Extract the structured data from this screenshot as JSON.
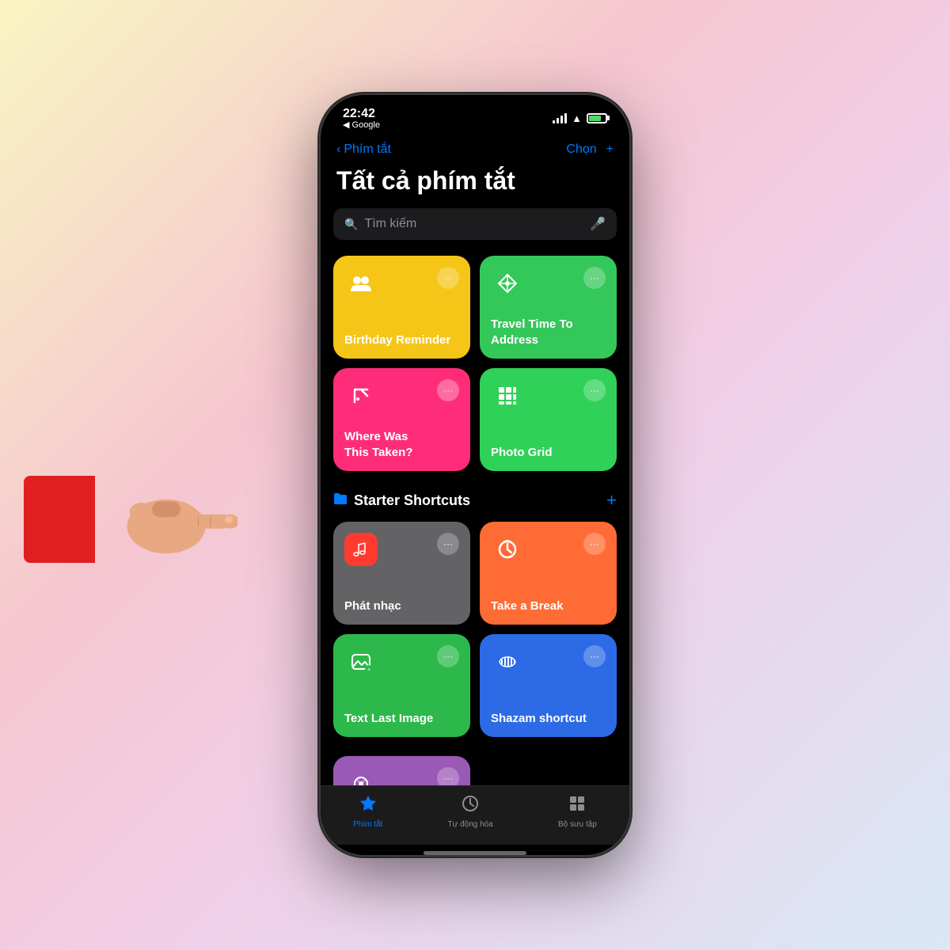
{
  "background": {
    "gradient": "linear-gradient(135deg, #f9f5c2, #f5c6d0, #e8d5f0, #d0e8f5)"
  },
  "statusBar": {
    "time": "22:42",
    "backLabel": "◀ Google",
    "timeIcon": "▶"
  },
  "navigation": {
    "backLabel": "Phím tắt",
    "title": "",
    "chooseLabel": "Chọn",
    "addLabel": "+"
  },
  "pageTitle": "Tất cả phím tắt",
  "search": {
    "placeholder": "Tìm kiếm"
  },
  "myShortcuts": [
    {
      "id": "birthday",
      "name": "Birthday Reminder",
      "icon": "👥",
      "color": "card-yellow"
    },
    {
      "id": "travel",
      "name": "Travel Time To Address",
      "icon": "✨",
      "color": "card-green"
    },
    {
      "id": "where-taken",
      "name": "Where Was This Taken?",
      "icon": "✨",
      "color": "card-pink"
    },
    {
      "id": "photo-grid",
      "name": "Photo Grid",
      "icon": "⊞",
      "color": "card-green2"
    }
  ],
  "starterSection": {
    "title": "Starter Shortcuts",
    "icon": "📁"
  },
  "starterShortcuts": [
    {
      "id": "music",
      "name": "Phát nhạc",
      "icon": "🎵",
      "color": "card-gray"
    },
    {
      "id": "break",
      "name": "Take a Break",
      "icon": "⏰",
      "color": "card-orange"
    },
    {
      "id": "text-image",
      "name": "Text Last Image",
      "icon": "💬",
      "color": "card-green3"
    },
    {
      "id": "shazam",
      "name": "Shazam shortcut",
      "icon": "〜",
      "color": "card-blue"
    }
  ],
  "partialCard": {
    "id": "partial",
    "icon": "◎",
    "color": "card-purple"
  },
  "tabBar": {
    "tabs": [
      {
        "id": "shortcuts",
        "label": "Phím tắt",
        "icon": "🔖",
        "active": true
      },
      {
        "id": "automation",
        "label": "Tự động hóa",
        "icon": "⏱",
        "active": false
      },
      {
        "id": "gallery",
        "label": "Bộ sưu tập",
        "icon": "☰",
        "active": false
      }
    ]
  }
}
